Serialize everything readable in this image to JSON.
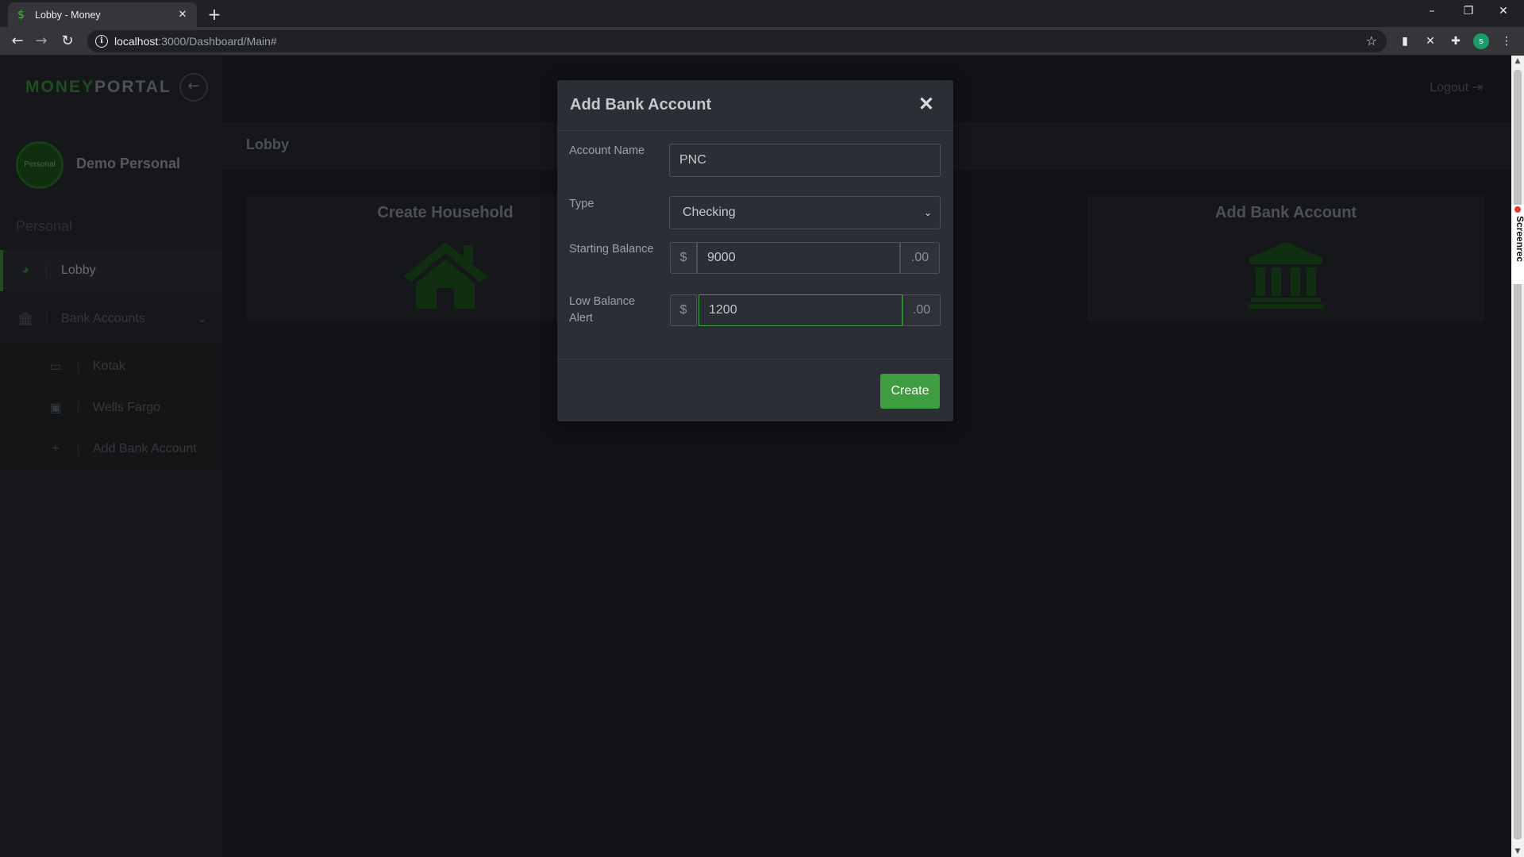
{
  "browser": {
    "tab_title": "Lobby - Money",
    "favicon": "$",
    "url_host": "localhost",
    "url_path": ":3000/Dashboard/Main#",
    "profile_initial": "s"
  },
  "app": {
    "brand_part1": "MONEY",
    "brand_part2": "PORTAL",
    "avatar_text": "Personal",
    "user_name": "Demo Personal",
    "section_label": "Personal",
    "nav": {
      "lobby": "Lobby",
      "bank_accounts": "Bank Accounts",
      "sub_items": [
        "Kotak",
        "Wells Fargo",
        "Add Bank Account"
      ]
    },
    "logout": "Logout",
    "breadcrumb": "Lobby",
    "cards": {
      "create_household": "Create Household",
      "add_bank_account": "Add Bank Account"
    }
  },
  "modal": {
    "title": "Add Bank Account",
    "close": "✕",
    "account_name_label": "Account Name",
    "account_name_value": "PNC",
    "type_label": "Type",
    "type_value": "Checking",
    "starting_balance_label": "Starting Balance",
    "starting_balance_prefix": "$",
    "starting_balance_value": "9000",
    "starting_balance_suffix": ".00",
    "low_balance_label": "Low Balance Alert",
    "low_balance_prefix": "$",
    "low_balance_value": "1200",
    "low_balance_suffix": ".00",
    "create_label": "Create"
  },
  "colors": {
    "accent": "#3d9d3f",
    "sidebar_bg": "#2b2f35",
    "page_bg": "#22252a"
  },
  "overlay_watermark": "Screenrec"
}
